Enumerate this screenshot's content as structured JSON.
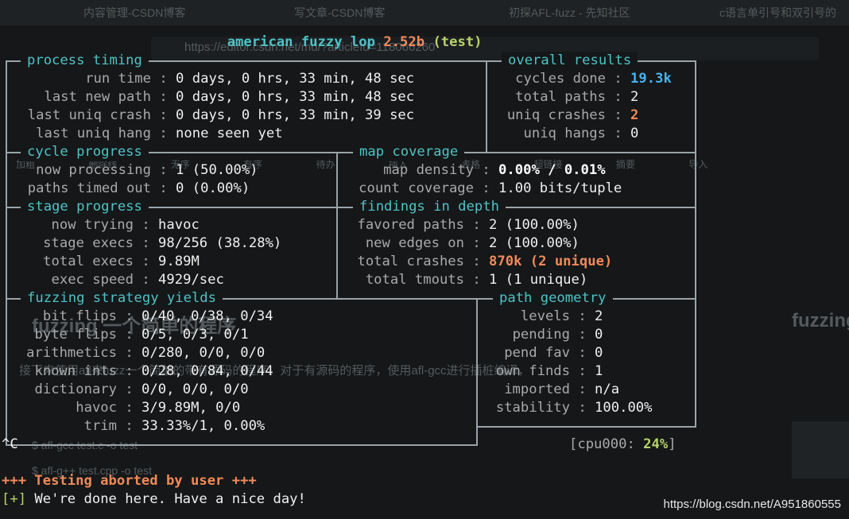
{
  "header": {
    "name": "american fuzzy lop",
    "version": "2.52b",
    "target": "(test)"
  },
  "process_timing": {
    "title": "process timing",
    "run_time_label": "run time",
    "run_time": "0 days, 0 hrs, 33 min, 48 sec",
    "last_new_path_label": "last new path",
    "last_new_path": "0 days, 0 hrs, 33 min, 48 sec",
    "last_uniq_crash_label": "last uniq crash",
    "last_uniq_crash": "0 days, 0 hrs, 33 min, 39 sec",
    "last_uniq_hang_label": "last uniq hang",
    "last_uniq_hang": "none seen yet"
  },
  "overall_results": {
    "title": "overall results",
    "cycles_done_label": "cycles done",
    "cycles_done": "19.3k",
    "total_paths_label": "total paths",
    "total_paths": "2",
    "uniq_crashes_label": "uniq crashes",
    "uniq_crashes": "2",
    "uniq_hangs_label": "uniq hangs",
    "uniq_hangs": "0"
  },
  "cycle_progress": {
    "title": "cycle progress",
    "now_processing_label": "now processing",
    "now_processing": "1 (50.00%)",
    "paths_timed_out_label": "paths timed out",
    "paths_timed_out": "0 (0.00%)"
  },
  "map_coverage": {
    "title": "map coverage",
    "map_density_label": "map density",
    "map_density": "0.00% / 0.01%",
    "count_coverage_label": "count coverage",
    "count_coverage": "1.00 bits/tuple"
  },
  "stage_progress": {
    "title": "stage progress",
    "now_trying_label": "now trying",
    "now_trying": "havoc",
    "stage_execs_label": "stage execs",
    "stage_execs": "98/256 (38.28%)",
    "total_execs_label": "total execs",
    "total_execs": "9.89M",
    "exec_speed_label": "exec speed",
    "exec_speed": "4929/sec"
  },
  "findings": {
    "title": "findings in depth",
    "favored_paths_label": "favored paths",
    "favored_paths": "2 (100.00%)",
    "new_edges_label": "new edges on",
    "new_edges": "2 (100.00%)",
    "total_crashes_label": "total crashes",
    "total_crashes": "870k (2 unique)",
    "total_tmouts_label": "total tmouts",
    "total_tmouts": "1 (1 unique)"
  },
  "strategy": {
    "title": "fuzzing strategy yields",
    "bit_flips_label": "bit flips",
    "bit_flips": "0/40, 0/38, 0/34",
    "byte_flips_label": "byte flips",
    "byte_flips": "0/5, 0/3, 0/1",
    "arithmetics_label": "arithmetics",
    "arithmetics": "0/280, 0/0, 0/0",
    "known_ints_label": "known ints",
    "known_ints": "0/28, 0/84, 0/44",
    "dictionary_label": "dictionary",
    "dictionary": "0/0, 0/0, 0/0",
    "havoc_label": "havoc",
    "havoc": "3/9.89M, 0/0",
    "trim_label": "trim",
    "trim": "33.33%/1, 0.00%"
  },
  "path_geometry": {
    "title": "path geometry",
    "levels_label": "levels",
    "levels": "2",
    "pending_label": "pending",
    "pending": "0",
    "pend_fav_label": "pend fav",
    "pend_fav": "0",
    "own_finds_label": "own finds",
    "own_finds": "1",
    "imported_label": "imported",
    "imported": "n/a",
    "stability_label": "stability",
    "stability": "100.00%"
  },
  "cpu": {
    "label": "cpu000:",
    "value": "24%"
  },
  "footer": {
    "ctrl_c": "^C",
    "aborted": "+++ Testing aborted by user +++",
    "done_tag": "[+]",
    "done_msg": "We're done here. Have a nice day!"
  },
  "watermark": "https://blog.csdn.net/A951860555",
  "background_ghost": {
    "tab1": "内容管理-CSDN博客",
    "tab2": "写文章-CSDN博客",
    "tab3": "初探AFL-fuzz - 先知社区",
    "tab4": "c语言单引号和双引号的",
    "url": "https://editor.csdn.net/md/?articleId=118066260",
    "toolbar": [
      "加粗",
      "删除线",
      "无序",
      "有序",
      "待办",
      "插入",
      "表格",
      "超链接",
      "摘要",
      "导入"
    ],
    "heading": "fuzzing 一个简单的程序",
    "para1": "接下来使用afl来fuzz一个简单的带有源码的程序。对于有源码的程序，使用afl-gcc进行插桩编译，",
    "code1": "$ afl-gcc test.c -o test",
    "code2": "$ afl-g++ test.cpp -o test",
    "side_heading": "fuzzing"
  },
  "colors": {
    "background": "#151718",
    "border": "#9aa3a8",
    "section_title": "#4fc3c7",
    "label": "#a8aaab",
    "value": "#f0f0f0",
    "blue": "#47b3f0",
    "orange": "#f08a5a",
    "green": "#b5d36a"
  }
}
